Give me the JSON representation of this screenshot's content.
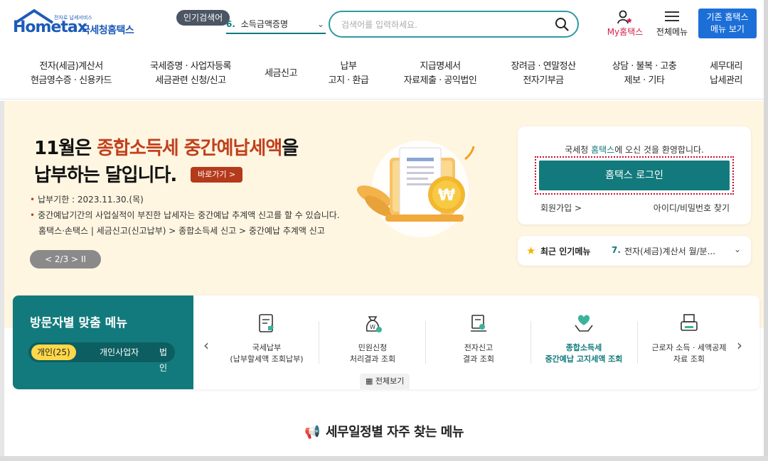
{
  "header": {
    "logo_small": "전자로 납세서비스",
    "logo_main": "Hometax",
    "logo_kr": "국세청홈택스",
    "popular_badge": "인기검색어",
    "popular_num": "6.",
    "popular_text": "소득금액증명",
    "search_placeholder": "검색어를 입력하세요.",
    "my_home": "My홈택스",
    "all_menu": "전체메뉴",
    "old_hometax_line1": "기존 홈택스",
    "old_hometax_line2": "메뉴 보기"
  },
  "gnb": [
    {
      "line1": "전자(세금)계산서",
      "line2": "현금영수증 · 신용카드"
    },
    {
      "line1": "국세증명 · 사업자등록",
      "line2": "세금관련 신청/신고"
    },
    {
      "line1": "세금신고",
      "line2": ""
    },
    {
      "line1": "납부",
      "line2": "고지 · 환급"
    },
    {
      "line1": "지급명세서",
      "line2": "자료제출 · 공익법인"
    },
    {
      "line1": "장려금 · 연말정산",
      "line2": "전자기부금"
    },
    {
      "line1": "상담 · 불복 · 고충",
      "line2": "제보 · 기타"
    },
    {
      "line1": "세무대리",
      "line2": "납세관리"
    }
  ],
  "hero": {
    "title_a": "11월은 ",
    "title_highlight": "종합소득세 중간예납세액",
    "title_b": "을",
    "title_line2": "납부하는 달입니다.",
    "go_button": "바로가기 >",
    "deadline": "납부기한 : 2023.11.30.(목)",
    "notice": "중간예납기간의 사업실적이 부진한 납세자는 중간예납 추계액 신고를 할 수 있습니다.",
    "path": "홈택스·손택스 | 세금신고(신고납부) > 종합소득세 신고 > 중간예납 추계액 신고",
    "pager": "< 2/3 > II"
  },
  "login": {
    "welcome_a": "국세청 ",
    "welcome_teal": "홈택스",
    "welcome_b": "에 오신 것을 환영합니다.",
    "login_button": "홈택스 로그인",
    "join": "회원가입 >",
    "find": "아이디/비밀번호 찾기"
  },
  "recent": {
    "label": "최근 인기메뉴",
    "num": "7.",
    "text": "전자(세금)계산서 월/분..."
  },
  "visitor": {
    "title": "방문자별 맞춤 메뉴",
    "tabs": [
      "개인(25)",
      "개인사업자",
      "법인"
    ],
    "menus": [
      {
        "line1": "국세납부",
        "line2": "(납부할세액 조회납부)"
      },
      {
        "line1": "민원신청",
        "line2": "처리결과 조회"
      },
      {
        "line1": "전자신고",
        "line2": "결과 조회"
      },
      {
        "line1": "종합소득세",
        "line2": "중간예납 고지세액 조회"
      },
      {
        "line1": "근로자 소득 · 세액공제",
        "line2": "자료 조회"
      }
    ],
    "view_all": "전체보기"
  },
  "section": {
    "title": "세무일정별 자주 찾는 메뉴"
  },
  "colors": {
    "teal": "#127a7c",
    "accent_red": "#c0401d",
    "brand_blue": "#1d5bb8",
    "hero_bg": "#fff6e2"
  }
}
